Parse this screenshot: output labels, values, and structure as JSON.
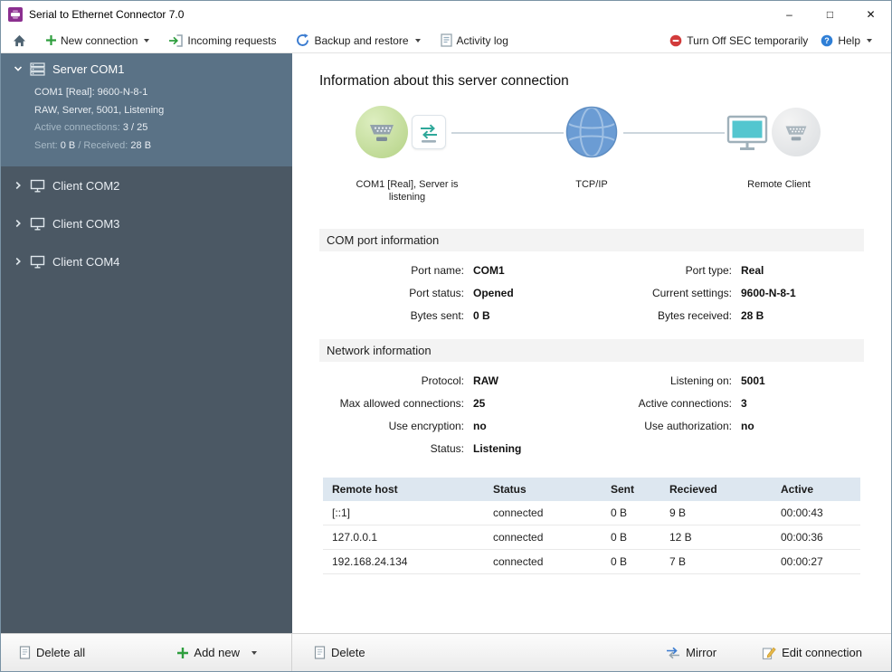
{
  "window": {
    "title": "Serial to Ethernet Connector 7.0",
    "controls": {
      "minimize": "–",
      "maximize": "□",
      "close": "✕"
    }
  },
  "toolbar": {
    "new_connection": "New connection",
    "incoming_requests": "Incoming requests",
    "backup_restore": "Backup and restore",
    "activity_log": "Activity log",
    "turn_off": "Turn Off SEC temporarily",
    "help": "Help"
  },
  "sidebar": {
    "server": {
      "label": "Server COM1",
      "line1": "COM1 [Real]: 9600-N-8-1",
      "line2": "RAW, Server, 5001, Listening",
      "active_label": "Active connections: ",
      "active_value": "3 / 25",
      "sent_label": "Sent: ",
      "sent_value": "0 B",
      "received_label": " / Received: ",
      "received_value": "28 B"
    },
    "clients": [
      {
        "label": "Client COM2"
      },
      {
        "label": "Client COM3"
      },
      {
        "label": "Client COM4"
      }
    ],
    "footer": {
      "delete_all": "Delete all",
      "add_new": "Add new"
    }
  },
  "main": {
    "title": "Information about this server connection",
    "diagram": {
      "label_server": "COM1 [Real], Server is listening",
      "label_network": "TCP/IP",
      "label_client": "Remote Client"
    },
    "com_section": {
      "title": "COM port information",
      "rows": [
        {
          "l_label": "Port name:",
          "l_value": "COM1",
          "r_label": "Port type:",
          "r_value": "Real"
        },
        {
          "l_label": "Port status:",
          "l_value": "Opened",
          "r_label": "Current settings:",
          "r_value": "9600-N-8-1"
        },
        {
          "l_label": "Bytes sent:",
          "l_value": "0 B",
          "r_label": "Bytes received:",
          "r_value": "28 B"
        }
      ]
    },
    "network_section": {
      "title": "Network information",
      "rows": [
        {
          "l_label": "Protocol:",
          "l_value": "RAW",
          "r_label": "Listening on:",
          "r_value": "5001"
        },
        {
          "l_label": "Max allowed connections:",
          "l_value": "25",
          "r_label": "Active connections:",
          "r_value": "3"
        },
        {
          "l_label": "Use encryption:",
          "l_value": "no",
          "r_label": "Use authorization:",
          "r_value": "no"
        },
        {
          "l_label": "Status:",
          "l_value": "Listening",
          "r_label": "",
          "r_value": ""
        }
      ]
    },
    "connections_table": {
      "headers": [
        "Remote host",
        "Status",
        "Sent",
        "Recieved",
        "Active"
      ],
      "rows": [
        [
          "[::1]",
          "connected",
          "0 B",
          "9 B",
          "00:00:43"
        ],
        [
          "127.0.0.1",
          "connected",
          "0 B",
          "12 B",
          "00:00:36"
        ],
        [
          "192.168.24.134",
          "connected",
          "0 B",
          "7 B",
          "00:00:27"
        ]
      ]
    },
    "footer": {
      "delete": "Delete",
      "mirror": "Mirror",
      "edit": "Edit connection"
    }
  },
  "icons": {
    "app": "purple connector badge",
    "home": "house",
    "new_connection": "green plus",
    "incoming_requests": "green inbound arrow",
    "backup_restore": "blue circular arrows",
    "activity_log": "document with lines",
    "turn_off": "red stop circle",
    "help": "blue question circle",
    "server": "server stack",
    "client": "monitor",
    "serial_device": "green circle with serial port",
    "switch": "adapter with teal arrows",
    "network": "blue globe",
    "remote_monitor": "teal screen monitor",
    "delete": "gray document",
    "add_new": "green plus",
    "mirror": "blue swap arrows",
    "edit": "pencil over page"
  },
  "colors": {
    "sidebar_bg": "#4b5864",
    "sidebar_selected_bg": "#5a7286",
    "accent_green": "#2e9e3e",
    "accent_blue": "#3a7bd0",
    "table_header_bg": "#dde7f0",
    "app_icon_purple": "#8b2f8f",
    "stop_red": "#d23b3b"
  }
}
